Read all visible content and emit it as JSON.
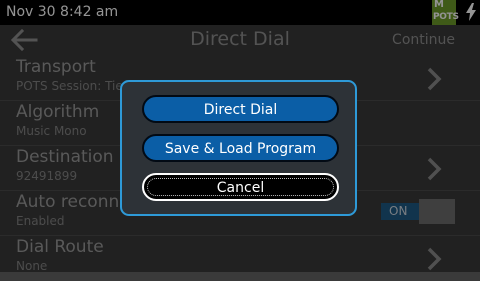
{
  "status_bar": {
    "time": "Nov 30 8:42 am",
    "badge_top": "M",
    "badge_bottom": "POTS",
    "badge_color": "#6d9b2a"
  },
  "header": {
    "title": "Direct Dial",
    "back_icon": "back-arrow-icon",
    "continue_label": "Continue"
  },
  "settings": [
    {
      "label": "Transport",
      "value": "POTS Session: Tie",
      "control": "chevron"
    },
    {
      "label": "Algorithm",
      "value": "Music Mono",
      "control": "none"
    },
    {
      "label": "Destination",
      "value": "92491899",
      "control": "chevron"
    },
    {
      "label": "Auto reconnect",
      "value": "Enabled",
      "control": "toggle",
      "toggle_label": "ON"
    },
    {
      "label": "Dial Route",
      "value": "None",
      "control": "chevron"
    }
  ],
  "dialog": {
    "buttons": [
      {
        "label": "Direct Dial"
      },
      {
        "label": "Save & Load Program"
      },
      {
        "label": "Cancel"
      }
    ],
    "border_color": "#2e9ad8",
    "button_color": "#0b5ea6"
  }
}
